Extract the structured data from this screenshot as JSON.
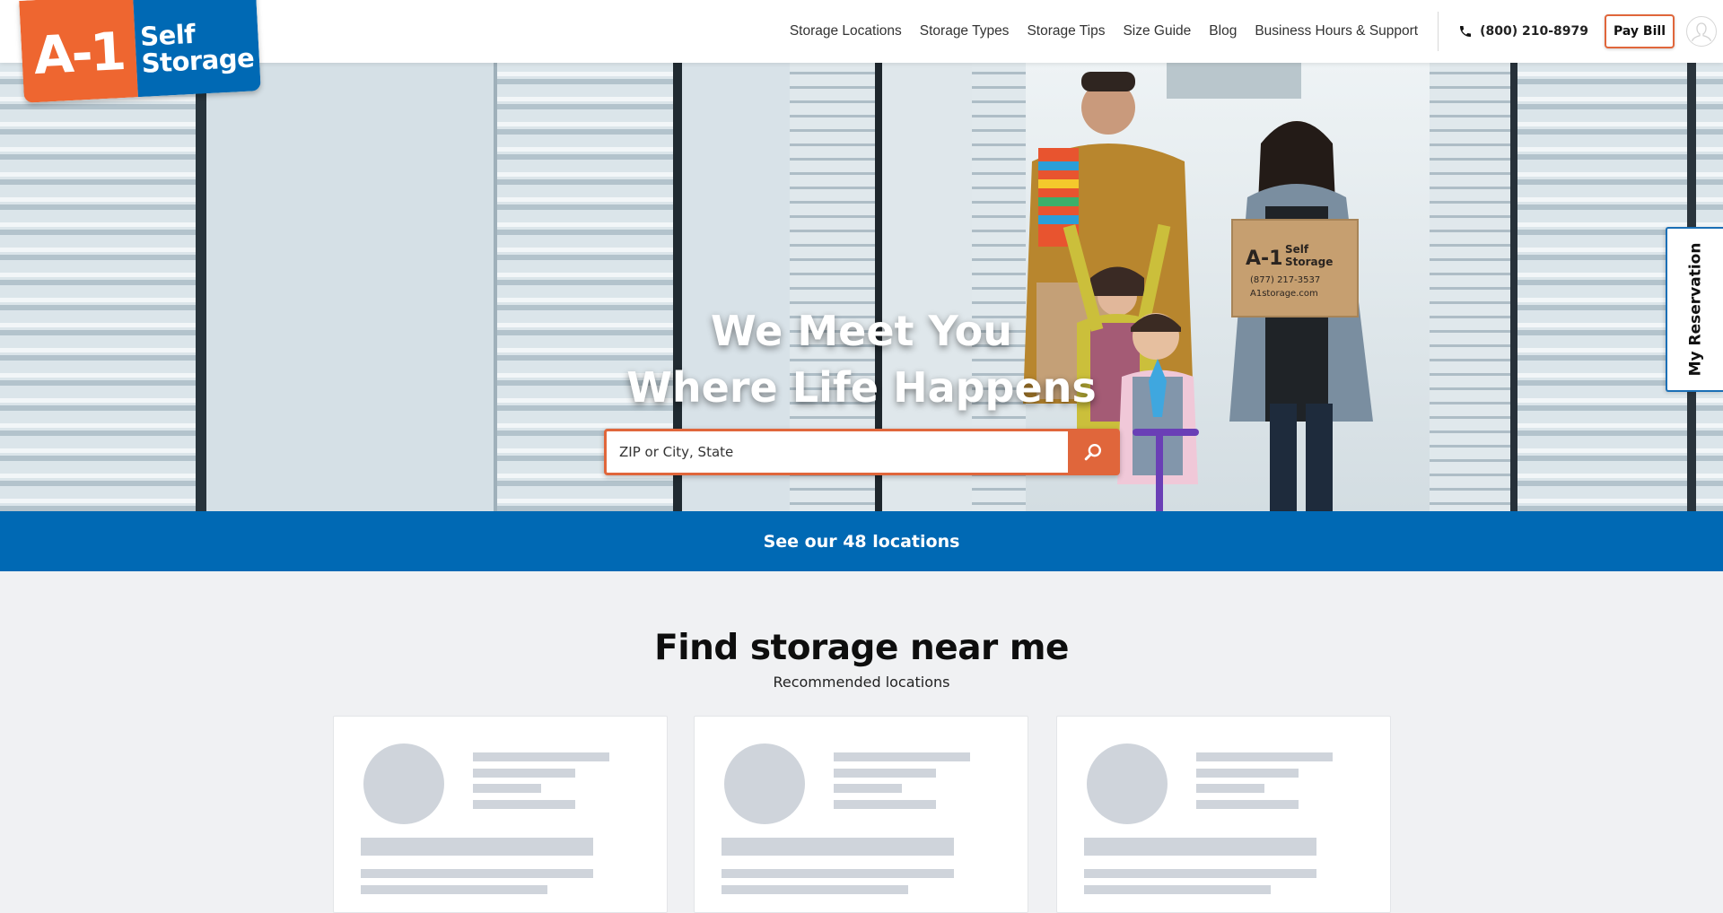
{
  "brand": {
    "logo_left_text": "A-1",
    "logo_right_line1": "Self",
    "logo_right_line2": "Storage",
    "colors": {
      "orange": "#ee6630",
      "blue": "#0069b4",
      "accent_border": "#e0663b"
    }
  },
  "header": {
    "nav": [
      {
        "label": "Storage Locations"
      },
      {
        "label": "Storage Types"
      },
      {
        "label": "Storage Tips"
      },
      {
        "label": "Size Guide"
      },
      {
        "label": "Blog"
      },
      {
        "label": "Business Hours & Support"
      }
    ],
    "phone": {
      "icon": "phone-icon",
      "label": "(800) 210-8979"
    },
    "pay_bill_label": "Pay Bill",
    "account_icon": "user-avatar-icon"
  },
  "hero": {
    "title_line1": "We Meet You",
    "title_line2": "Where Life Happens",
    "search": {
      "placeholder": "ZIP or City, State",
      "value": "",
      "button_icon": "search-icon"
    },
    "box_text": {
      "brand": "A-1 Self Storage",
      "phone": "(877) 217-3537",
      "site": "A1storage.com"
    }
  },
  "reservation_tab": {
    "label": "My Reservation"
  },
  "banner": {
    "label": "See our 48 locations"
  },
  "find": {
    "title": "Find storage near me",
    "subtitle": "Recommended locations",
    "cards": [
      {
        "state": "loading"
      },
      {
        "state": "loading"
      },
      {
        "state": "loading"
      }
    ]
  }
}
